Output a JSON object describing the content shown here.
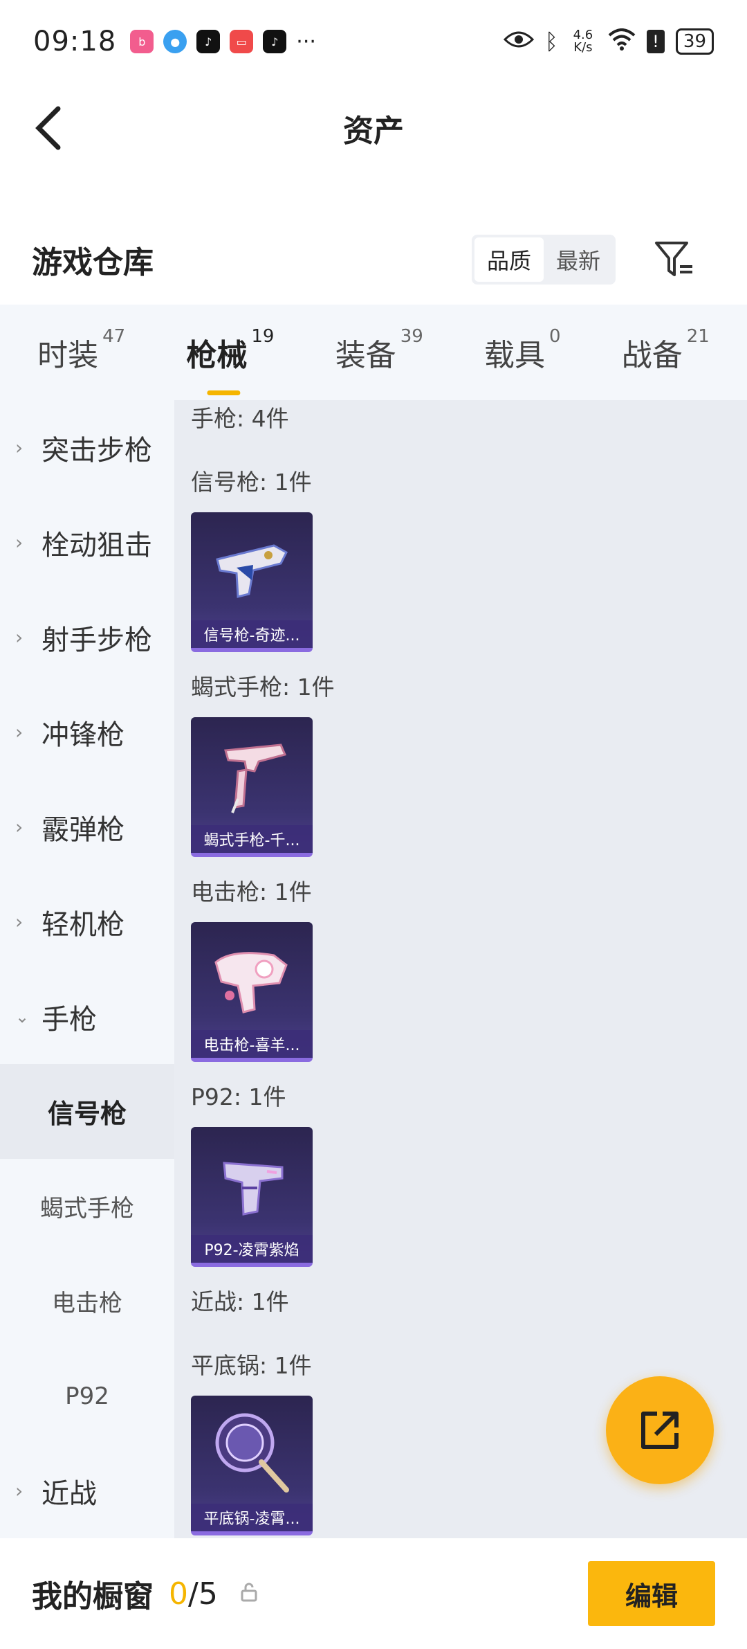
{
  "status": {
    "time": "09:18",
    "net_speed": "4.6 K/s",
    "battery": "39",
    "more": "···"
  },
  "header": {
    "title": "资产"
  },
  "warehouse": {
    "title": "游戏仓库",
    "sort_options": [
      "品质",
      "最新"
    ],
    "active_sort": "品质"
  },
  "tabs": [
    {
      "label": "时装",
      "count": "47"
    },
    {
      "label": "枪械",
      "count": "19"
    },
    {
      "label": "装备",
      "count": "39"
    },
    {
      "label": "载具",
      "count": "0"
    },
    {
      "label": "战备",
      "count": "21"
    }
  ],
  "sidebar": {
    "categories_top": [
      "突击步枪",
      "栓动狙击",
      "射手步枪",
      "冲锋枪",
      "霰弹枪",
      "轻机枪"
    ],
    "expanded": "手枪",
    "subcategories": [
      "信号枪",
      "蝎式手枪",
      "电击枪",
      "P92"
    ],
    "active_sub": "信号枪",
    "categories_bottom": [
      "近战"
    ]
  },
  "content": {
    "groups": [
      {
        "title": "手枪: 4件"
      },
      {
        "title": "信号枪: 1件",
        "item": "信号枪-奇迹..."
      },
      {
        "title": "蝎式手枪: 1件",
        "item": "蝎式手枪-千..."
      },
      {
        "title": "电击枪: 1件",
        "item": "电击枪-喜羊..."
      },
      {
        "title": "P92: 1件",
        "item": "P92-凌霄紫焰"
      },
      {
        "title": "近战: 1件"
      },
      {
        "title": "平底锅: 1件",
        "item": "平底锅-凌霄..."
      }
    ]
  },
  "bottom": {
    "label": "我的橱窗",
    "current": "0",
    "total": "/5",
    "edit": "编辑"
  },
  "colors": {
    "accent": "#f5b500",
    "card_bg": "#2c2550",
    "sidebar_bg": "#f4f7fb",
    "content_bg": "#e9ecf2"
  }
}
